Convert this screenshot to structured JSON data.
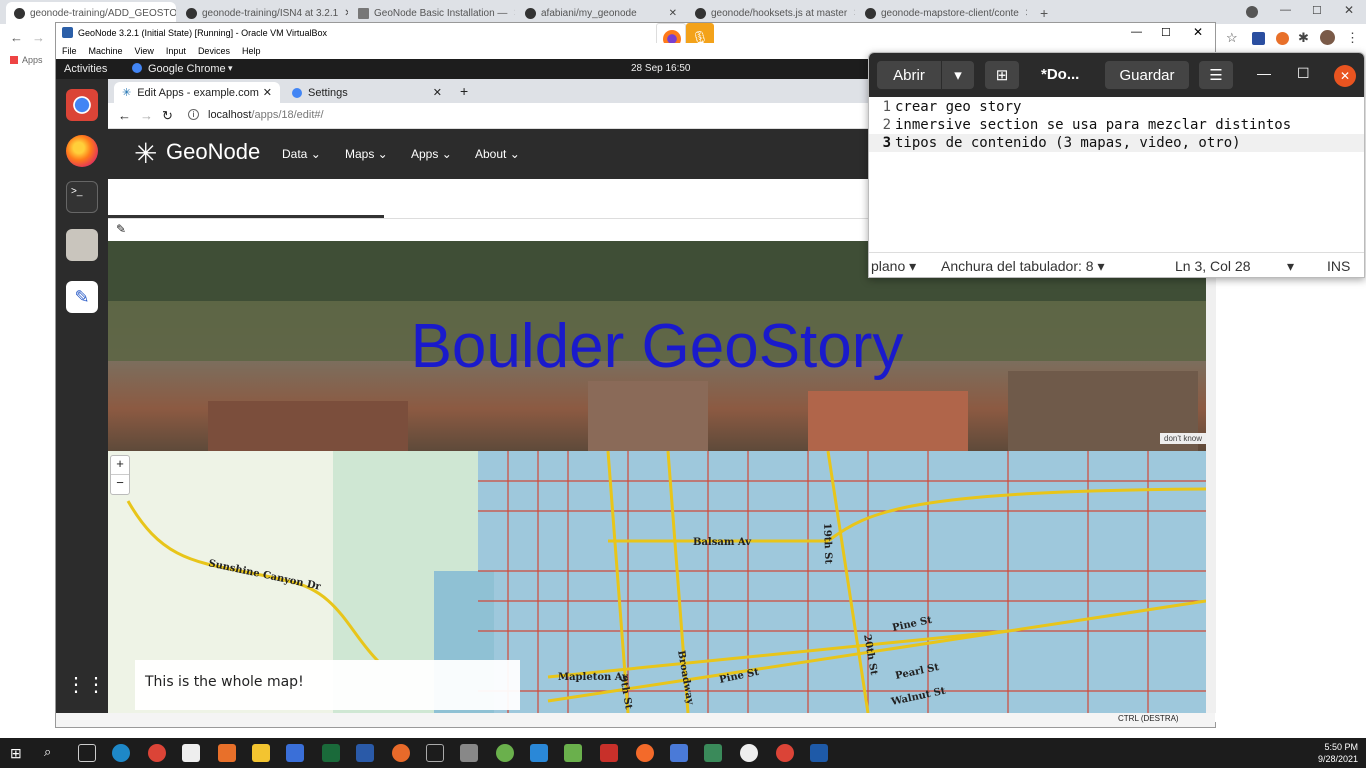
{
  "host": {
    "tabs": [
      {
        "label": "geonode-training/ADD_GEOSTO"
      },
      {
        "label": "geonode-training/ISN4 at 3.2.1"
      },
      {
        "label": "GeoNode Basic Installation —"
      },
      {
        "label": "afabiani/my_geonode"
      },
      {
        "label": "geonode/hooksets.js at master"
      },
      {
        "label": "geonode-mapstore-client/conte"
      }
    ],
    "new_tab": "+",
    "apps_label": "Apps"
  },
  "vm": {
    "title": "GeoNode 3.2.1 (Initial State) [Running] - Oracle VM VirtualBox",
    "menu": [
      "File",
      "Machine",
      "View",
      "Input",
      "Devices",
      "Help"
    ],
    "status_hint": "CTRL (DESTRA)"
  },
  "guest": {
    "activities": "Activities",
    "app_name": "Google Chrome",
    "clock": "28 Sep  16:50"
  },
  "chrome": {
    "tabs": [
      {
        "label": "Edit Apps - example.com"
      },
      {
        "label": "Settings"
      }
    ],
    "url_host": "localhost",
    "url_path": "/apps/18/edit#/"
  },
  "geonode": {
    "logo": "GeoNode",
    "nav": [
      "Data",
      "Maps",
      "Apps",
      "About"
    ]
  },
  "story": {
    "hero_title": "Boulder GeoStory",
    "hero_credit": "don't know",
    "map_caption": "This is the whole map!",
    "zoom_in": "+",
    "zoom_out": "−",
    "map_labels": [
      "Sunshine Canyon Dr",
      "Balsam Av",
      "19th St",
      "Pine St",
      "20th St",
      "Mapleton Av",
      "9th St",
      "Broadway",
      "Pine St",
      "Pearl St",
      "Walnut St"
    ]
  },
  "gedit": {
    "open_label": "Abrir",
    "title": "*Do...",
    "save_label": "Guardar",
    "lines": [
      {
        "n": "1",
        "text": "crear geo story"
      },
      {
        "n": "2",
        "text": "inmersive section se usa para mezclar distintos"
      },
      {
        "n": "3",
        "text": "tipos de contenido (3 mapas, video, otro)"
      }
    ],
    "status": {
      "syntax": "plano",
      "tab_width": "Anchura del tabulador: 8",
      "position": "Ln 3, Col 28",
      "mode": "INS"
    }
  },
  "taskbar": {
    "time": "5:50 PM",
    "date": "9/28/2021"
  },
  "colors": {
    "hero_title": "#1a1acc",
    "geonode_nav": "#2c2c2c",
    "gedit_header": "#2b2b2b",
    "close_red": "#e95420"
  }
}
